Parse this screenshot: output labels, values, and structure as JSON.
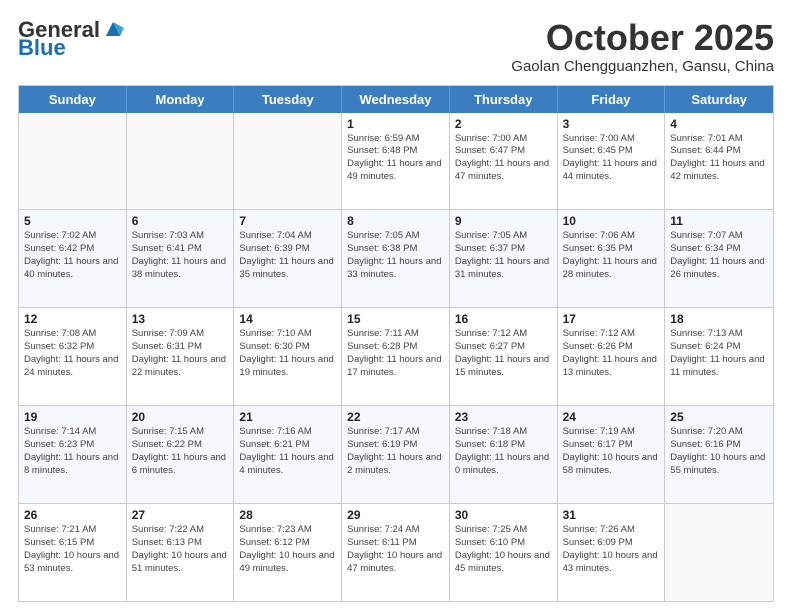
{
  "header": {
    "logo_general": "General",
    "logo_blue": "Blue",
    "month_title": "October 2025",
    "location": "Gaolan Chengguanzhen, Gansu, China"
  },
  "days_of_week": [
    "Sunday",
    "Monday",
    "Tuesday",
    "Wednesday",
    "Thursday",
    "Friday",
    "Saturday"
  ],
  "weeks": [
    [
      {
        "day": "",
        "info": ""
      },
      {
        "day": "",
        "info": ""
      },
      {
        "day": "",
        "info": ""
      },
      {
        "day": "1",
        "info": "Sunrise: 6:59 AM\nSunset: 6:48 PM\nDaylight: 11 hours and 49 minutes."
      },
      {
        "day": "2",
        "info": "Sunrise: 7:00 AM\nSunset: 6:47 PM\nDaylight: 11 hours and 47 minutes."
      },
      {
        "day": "3",
        "info": "Sunrise: 7:00 AM\nSunset: 6:45 PM\nDaylight: 11 hours and 44 minutes."
      },
      {
        "day": "4",
        "info": "Sunrise: 7:01 AM\nSunset: 6:44 PM\nDaylight: 11 hours and 42 minutes."
      }
    ],
    [
      {
        "day": "5",
        "info": "Sunrise: 7:02 AM\nSunset: 6:42 PM\nDaylight: 11 hours and 40 minutes."
      },
      {
        "day": "6",
        "info": "Sunrise: 7:03 AM\nSunset: 6:41 PM\nDaylight: 11 hours and 38 minutes."
      },
      {
        "day": "7",
        "info": "Sunrise: 7:04 AM\nSunset: 6:39 PM\nDaylight: 11 hours and 35 minutes."
      },
      {
        "day": "8",
        "info": "Sunrise: 7:05 AM\nSunset: 6:38 PM\nDaylight: 11 hours and 33 minutes."
      },
      {
        "day": "9",
        "info": "Sunrise: 7:05 AM\nSunset: 6:37 PM\nDaylight: 11 hours and 31 minutes."
      },
      {
        "day": "10",
        "info": "Sunrise: 7:06 AM\nSunset: 6:35 PM\nDaylight: 11 hours and 28 minutes."
      },
      {
        "day": "11",
        "info": "Sunrise: 7:07 AM\nSunset: 6:34 PM\nDaylight: 11 hours and 26 minutes."
      }
    ],
    [
      {
        "day": "12",
        "info": "Sunrise: 7:08 AM\nSunset: 6:32 PM\nDaylight: 11 hours and 24 minutes."
      },
      {
        "day": "13",
        "info": "Sunrise: 7:09 AM\nSunset: 6:31 PM\nDaylight: 11 hours and 22 minutes."
      },
      {
        "day": "14",
        "info": "Sunrise: 7:10 AM\nSunset: 6:30 PM\nDaylight: 11 hours and 19 minutes."
      },
      {
        "day": "15",
        "info": "Sunrise: 7:11 AM\nSunset: 6:28 PM\nDaylight: 11 hours and 17 minutes."
      },
      {
        "day": "16",
        "info": "Sunrise: 7:12 AM\nSunset: 6:27 PM\nDaylight: 11 hours and 15 minutes."
      },
      {
        "day": "17",
        "info": "Sunrise: 7:12 AM\nSunset: 6:26 PM\nDaylight: 11 hours and 13 minutes."
      },
      {
        "day": "18",
        "info": "Sunrise: 7:13 AM\nSunset: 6:24 PM\nDaylight: 11 hours and 11 minutes."
      }
    ],
    [
      {
        "day": "19",
        "info": "Sunrise: 7:14 AM\nSunset: 6:23 PM\nDaylight: 11 hours and 8 minutes."
      },
      {
        "day": "20",
        "info": "Sunrise: 7:15 AM\nSunset: 6:22 PM\nDaylight: 11 hours and 6 minutes."
      },
      {
        "day": "21",
        "info": "Sunrise: 7:16 AM\nSunset: 6:21 PM\nDaylight: 11 hours and 4 minutes."
      },
      {
        "day": "22",
        "info": "Sunrise: 7:17 AM\nSunset: 6:19 PM\nDaylight: 11 hours and 2 minutes."
      },
      {
        "day": "23",
        "info": "Sunrise: 7:18 AM\nSunset: 6:18 PM\nDaylight: 11 hours and 0 minutes."
      },
      {
        "day": "24",
        "info": "Sunrise: 7:19 AM\nSunset: 6:17 PM\nDaylight: 10 hours and 58 minutes."
      },
      {
        "day": "25",
        "info": "Sunrise: 7:20 AM\nSunset: 6:16 PM\nDaylight: 10 hours and 55 minutes."
      }
    ],
    [
      {
        "day": "26",
        "info": "Sunrise: 7:21 AM\nSunset: 6:15 PM\nDaylight: 10 hours and 53 minutes."
      },
      {
        "day": "27",
        "info": "Sunrise: 7:22 AM\nSunset: 6:13 PM\nDaylight: 10 hours and 51 minutes."
      },
      {
        "day": "28",
        "info": "Sunrise: 7:23 AM\nSunset: 6:12 PM\nDaylight: 10 hours and 49 minutes."
      },
      {
        "day": "29",
        "info": "Sunrise: 7:24 AM\nSunset: 6:11 PM\nDaylight: 10 hours and 47 minutes."
      },
      {
        "day": "30",
        "info": "Sunrise: 7:25 AM\nSunset: 6:10 PM\nDaylight: 10 hours and 45 minutes."
      },
      {
        "day": "31",
        "info": "Sunrise: 7:26 AM\nSunset: 6:09 PM\nDaylight: 10 hours and 43 minutes."
      },
      {
        "day": "",
        "info": ""
      }
    ]
  ]
}
